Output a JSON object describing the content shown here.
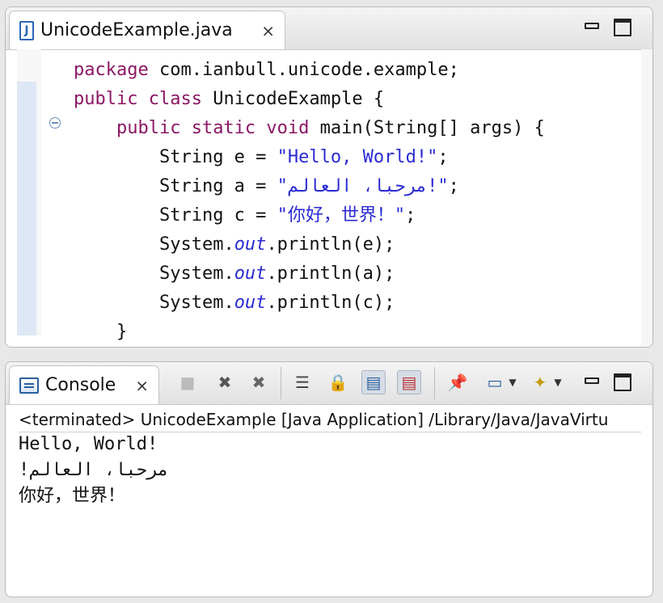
{
  "editor": {
    "tab_title": "UnicodeExample.java",
    "file_icon_letter": "J",
    "close_glyph": "⨯",
    "lines": [
      {
        "indent": "",
        "parts": [
          {
            "t": "package",
            "c": "kw"
          },
          {
            "t": " com.ianbull.unicode.example;",
            "c": ""
          }
        ]
      },
      {
        "indent": "",
        "parts": [
          {
            "t": "public class",
            "c": "kw"
          },
          {
            "t": " UnicodeExample {",
            "c": ""
          }
        ]
      },
      {
        "indent": "    ",
        "parts": [
          {
            "t": "public static void",
            "c": "kw"
          },
          {
            "t": " main(String[] args) {",
            "c": ""
          }
        ]
      },
      {
        "indent": "        ",
        "parts": [
          {
            "t": "String e = ",
            "c": ""
          },
          {
            "t": "\"Hello, World!\"",
            "c": "str"
          },
          {
            "t": ";",
            "c": ""
          }
        ]
      },
      {
        "indent": "        ",
        "parts": [
          {
            "t": "String a = ",
            "c": ""
          },
          {
            "t": "\"!مرحبا، العالم\"",
            "c": "str"
          },
          {
            "t": ";",
            "c": ""
          }
        ]
      },
      {
        "indent": "        ",
        "parts": [
          {
            "t": "String c = ",
            "c": ""
          },
          {
            "t": "\"你好，世界！\"",
            "c": "str"
          },
          {
            "t": ";",
            "c": ""
          }
        ]
      },
      {
        "indent": "        ",
        "parts": [
          {
            "t": "System.",
            "c": ""
          },
          {
            "t": "out",
            "c": "field"
          },
          {
            "t": ".println(e);",
            "c": ""
          }
        ]
      },
      {
        "indent": "        ",
        "parts": [
          {
            "t": "System.",
            "c": ""
          },
          {
            "t": "out",
            "c": "field"
          },
          {
            "t": ".println(a);",
            "c": ""
          }
        ]
      },
      {
        "indent": "        ",
        "parts": [
          {
            "t": "System.",
            "c": ""
          },
          {
            "t": "out",
            "c": "field"
          },
          {
            "t": ".println(c);",
            "c": ""
          }
        ]
      },
      {
        "indent": "    ",
        "parts": [
          {
            "t": "}",
            "c": ""
          }
        ]
      }
    ]
  },
  "console": {
    "tab_title": "Console",
    "close_glyph": "⨯",
    "status": "<terminated> UnicodeExample [Java Application] /Library/Java/JavaVirtu",
    "output": [
      "Hello, World!",
      "!مرحبا، العالم",
      "你好，世界！"
    ],
    "toolbar_icons": [
      "terminate-icon",
      "remove-launch-icon",
      "remove-all-terminated-icon",
      "scroll-lock-icon",
      "clear-console-icon",
      "show-on-stdout-icon",
      "show-on-stderr-icon",
      "pin-console-icon",
      "display-console-icon",
      "open-console-icon"
    ]
  },
  "colors": {
    "keyword": "#8b1764",
    "string": "#2a2ad4",
    "field": "#2a2ad4"
  }
}
